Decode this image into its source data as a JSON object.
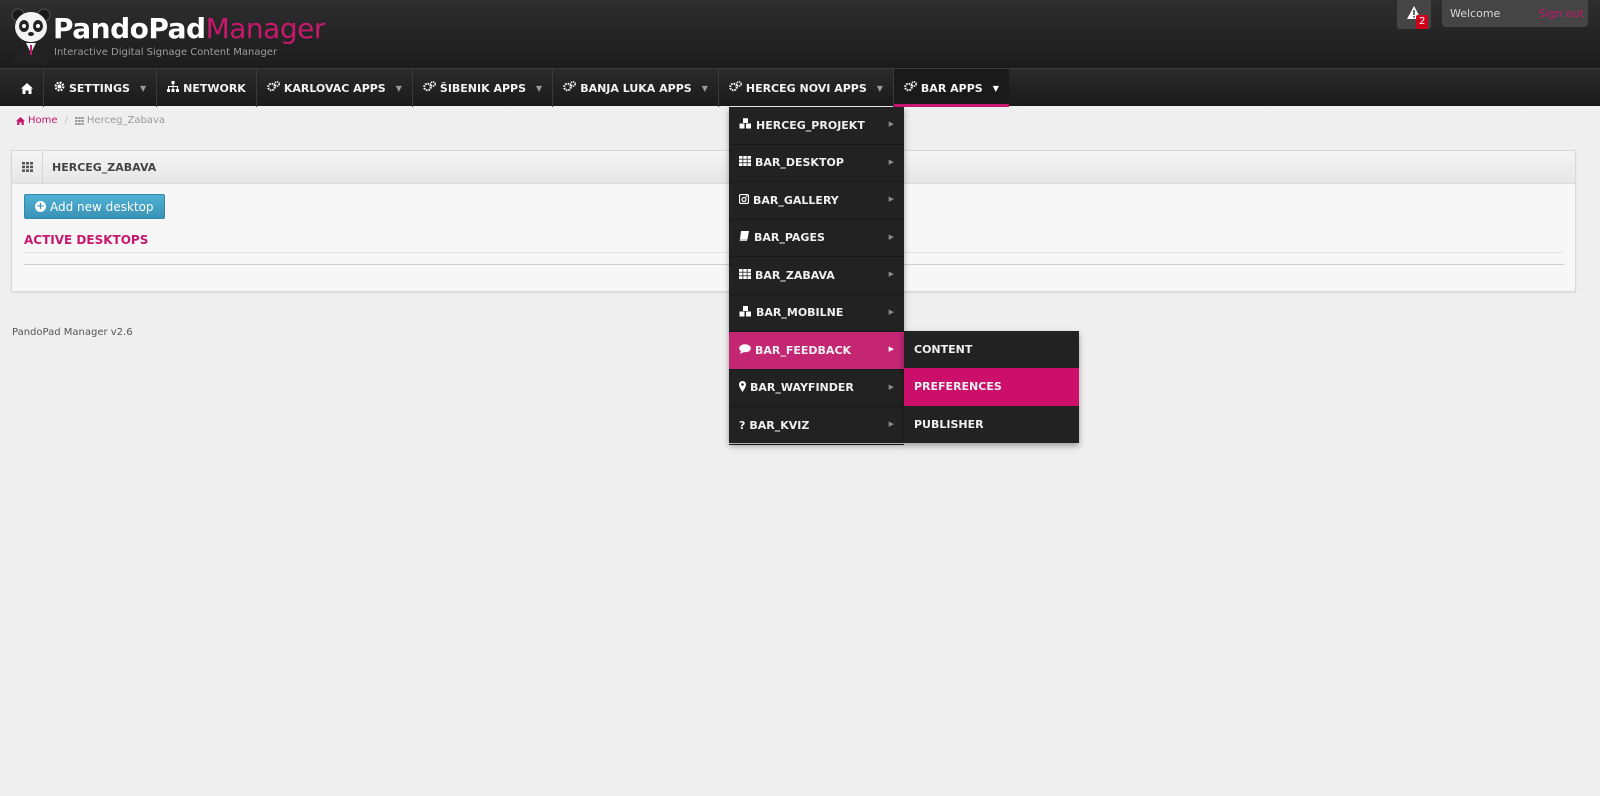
{
  "header": {
    "brand_primary": "PandoPad",
    "brand_secondary": "Manager",
    "tagline": "Interactive Digital Signage Content Manager",
    "alert_count": "2",
    "welcome": "Welcome",
    "signout": "Sign out"
  },
  "nav": {
    "items": [
      {
        "label": "",
        "icon": "home-icon",
        "caret": false
      },
      {
        "label": "SETTINGS",
        "icon": "gear-icon",
        "caret": true
      },
      {
        "label": "NETWORK",
        "icon": "sitemap-icon",
        "caret": false
      },
      {
        "label": "KARLOVAC APPS",
        "icon": "gears-icon",
        "caret": true
      },
      {
        "label": "ŠIBENIK APPS",
        "icon": "gears-icon",
        "caret": true
      },
      {
        "label": "BANJA LUKA APPS",
        "icon": "gears-icon",
        "caret": true
      },
      {
        "label": "HERCEG NOVI APPS",
        "icon": "gears-icon",
        "caret": true
      },
      {
        "label": "BAR APPS",
        "icon": "gears-icon",
        "caret": true,
        "active": true
      }
    ]
  },
  "breadcrumb": {
    "home": "Home",
    "current": "Herceg_Zabava"
  },
  "panel": {
    "title": "HERCEG_ZABAVA",
    "add_button": "Add new desktop",
    "section_title": "ACTIVE DESKTOPS"
  },
  "footer": {
    "version": "PandoPad Manager v2.6"
  },
  "dropdown": {
    "items": [
      {
        "label": "HERCEG_PROJEKT",
        "icon": "cubes-icon"
      },
      {
        "label": "BAR_DESKTOP",
        "icon": "th-icon"
      },
      {
        "label": "BAR_GALLERY",
        "icon": "instagram-icon"
      },
      {
        "label": "BAR_PAGES",
        "icon": "book-icon"
      },
      {
        "label": "BAR_ZABAVA",
        "icon": "th-icon"
      },
      {
        "label": "BAR_MOBILNE",
        "icon": "cubes-icon"
      },
      {
        "label": "BAR_FEEDBACK",
        "icon": "comment-icon",
        "active": true
      },
      {
        "label": "BAR_WAYFINDER",
        "icon": "map-marker-icon"
      },
      {
        "label": "BAR_KVIZ",
        "icon": "question-icon"
      }
    ]
  },
  "submenu": {
    "items": [
      {
        "label": "CONTENT"
      },
      {
        "label": "PREFERENCES",
        "active": true
      },
      {
        "label": "PUBLISHER"
      }
    ]
  },
  "colors": {
    "accent": "#c8186e",
    "header_bg": "#1c1c1c",
    "button_blue": "#3a93b6"
  }
}
